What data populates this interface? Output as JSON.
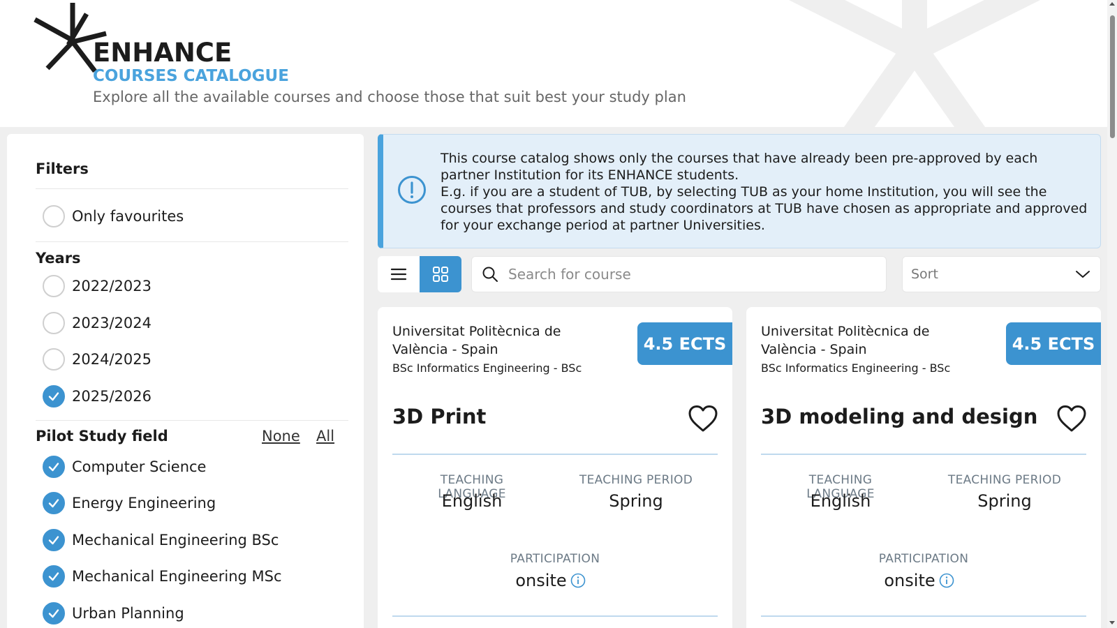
{
  "header": {
    "brand": "ENHANCE",
    "subtitle": "COURSES CATALOGUE",
    "tagline": "Explore all the available courses and choose those that suit best your study plan"
  },
  "sidebar": {
    "filters_title": "Filters",
    "only_favourites": {
      "label": "Only favourites",
      "checked": false
    },
    "years_title": "Years",
    "years": [
      {
        "label": "2022/2023",
        "checked": false
      },
      {
        "label": "2023/2024",
        "checked": false
      },
      {
        "label": "2024/2025",
        "checked": false
      },
      {
        "label": "2025/2026",
        "checked": true
      }
    ],
    "study_field_title": "Pilot Study field",
    "none_link": "None",
    "all_link": "All",
    "study_fields": [
      {
        "label": "Computer Science",
        "checked": true
      },
      {
        "label": "Energy Engineering",
        "checked": true
      },
      {
        "label": "Mechanical Engineering BSc",
        "checked": true
      },
      {
        "label": "Mechanical Engineering MSc",
        "checked": true
      },
      {
        "label": "Urban Planning",
        "checked": true
      }
    ]
  },
  "info": {
    "line1": "This course catalog shows only the courses that have already been pre-approved by each partner Institution for its ENHANCE students.",
    "line2": "E.g. if you are a student of TUB, by selecting TUB as your home Institution, you will see the courses that professors and study coordinators at TUB have chosen as appropriate and approved for your exchange period at partner Universities."
  },
  "toolbar": {
    "search_placeholder": "Search for course",
    "sort_label": "Sort",
    "active_view": "grid"
  },
  "courses": [
    {
      "university": "Universitat Politècnica de València - Spain",
      "program": "BSc Informatics Engineering - BSc",
      "ects": "4.5 ECTS",
      "title": "3D Print",
      "language_label": "TEACHING LANGUAGE",
      "language": "English",
      "period_label": "TEACHING PERIOD",
      "period": "Spring",
      "participation_label": "PARTICIPATION",
      "participation": "onsite"
    },
    {
      "university": "Universitat Politècnica de València - Spain",
      "program": "BSc Informatics Engineering - BSc",
      "ects": "4.5 ECTS",
      "title": "3D modeling and design",
      "language_label": "TEACHING LANGUAGE",
      "language": "English",
      "period_label": "TEACHING PERIOD",
      "period": "Spring",
      "participation_label": "PARTICIPATION",
      "participation": "onsite"
    }
  ],
  "colors": {
    "accent": "#3c93d0",
    "brand_blue": "#4aa3dd",
    "info_bg": "#e3eff9"
  }
}
